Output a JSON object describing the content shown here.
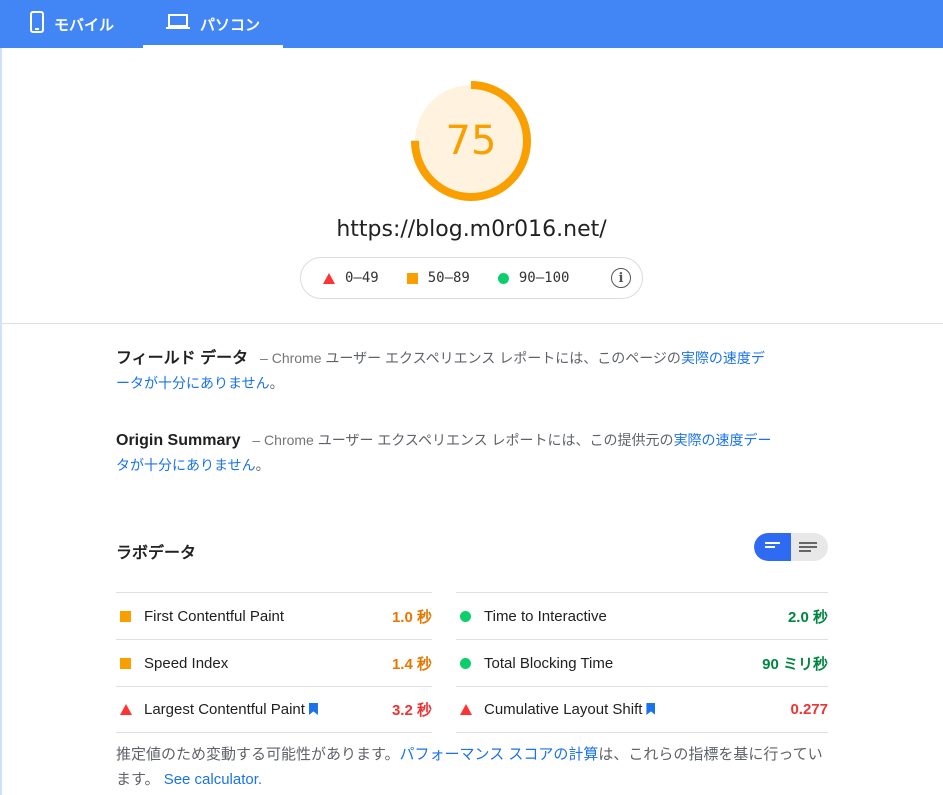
{
  "tabs": [
    {
      "label": "モバイル",
      "icon": "phone-icon",
      "active": false
    },
    {
      "label": "パソコン",
      "icon": "laptop-icon",
      "active": true
    }
  ],
  "gauge": {
    "score": "75",
    "fraction": 0.75,
    "color": "#fa9f00"
  },
  "url": "https://blog.m0r016.net/",
  "legend": [
    {
      "range": "0–49",
      "shape": "triangle",
      "color": "#ff3333"
    },
    {
      "range": "50–89",
      "shape": "square",
      "color": "#fa9f00"
    },
    {
      "range": "90–100",
      "shape": "circle",
      "color": "#0cce6b"
    }
  ],
  "field": {
    "title": "フィールド データ",
    "source": "– Chrome",
    "text": " ユーザー エクスペリエンス レポートには、このページの",
    "link": "実際の速度データが十分にありません",
    "end": "。"
  },
  "origin": {
    "title": "Origin Summary",
    "source": "– Chrome",
    "text": " ユーザー エクスペリエンス レポートには、この提供元の",
    "link": "実際の速度データが十分にありません",
    "end": "。"
  },
  "lab": {
    "title": "ラボデータ",
    "metrics_left": [
      {
        "name": "First Contentful Paint",
        "value": "1.0 秒",
        "rating": "average",
        "bookmark": false
      },
      {
        "name": "Speed Index",
        "value": "1.4 秒",
        "rating": "average",
        "bookmark": false
      },
      {
        "name": "Largest Contentful Paint",
        "value": "3.2 秒",
        "rating": "fail",
        "bookmark": true
      }
    ],
    "metrics_right": [
      {
        "name": "Time to Interactive",
        "value": "2.0 秒",
        "rating": "pass",
        "bookmark": false
      },
      {
        "name": "Total Blocking Time",
        "value": "90 ミリ秒",
        "rating": "pass",
        "bookmark": false
      },
      {
        "name": "Cumulative Layout Shift",
        "value": "0.277",
        "rating": "fail",
        "bookmark": true
      }
    ]
  },
  "footnote": {
    "text1": "推定値のため変動する可能性があります。",
    "link1": "パフォーマンス スコアの計算",
    "text2": "は、これらの指標を基に行っています。",
    "link2": "See calculator."
  }
}
